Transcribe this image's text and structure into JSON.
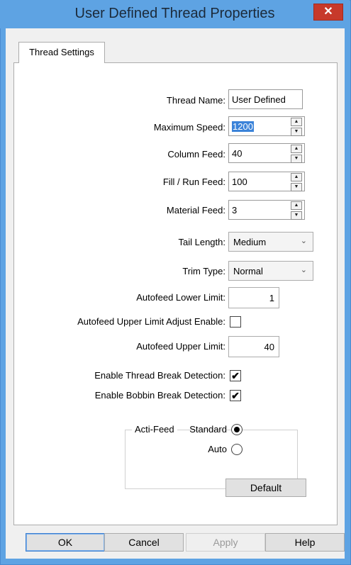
{
  "window": {
    "title": "User Defined Thread Properties",
    "close_glyph": "✕"
  },
  "tabs": [
    {
      "label": "Thread Settings"
    }
  ],
  "fields": {
    "thread_name": {
      "label": "Thread Name:",
      "value": "User Defined"
    },
    "maximum_speed": {
      "label": "Maximum Speed:",
      "value": "1200"
    },
    "column_feed": {
      "label": "Column Feed:",
      "value": "40"
    },
    "fill_run_feed": {
      "label": "Fill / Run Feed:",
      "value": "100"
    },
    "material_feed": {
      "label": "Material Feed:",
      "value": "3"
    },
    "tail_length": {
      "label": "Tail Length:",
      "value": "Medium"
    },
    "trim_type": {
      "label": "Trim Type:",
      "value": "Normal"
    },
    "autofeed_lower_limit": {
      "label": "Autofeed Lower Limit:",
      "value": "1"
    },
    "autofeed_upper_adjust": {
      "label": "Autofeed Upper Limit Adjust Enable:",
      "checked": false
    },
    "autofeed_upper_limit": {
      "label": "Autofeed Upper Limit:",
      "value": "40"
    },
    "thread_break_detection": {
      "label": "Enable Thread Break Detection:",
      "checked": true
    },
    "bobbin_break_detection": {
      "label": "Enable Bobbin Break Detection:",
      "checked": true
    }
  },
  "acti_feed": {
    "title": "Acti-Feed",
    "options": [
      {
        "label": "Standard",
        "selected": true
      },
      {
        "label": "Auto",
        "selected": false
      }
    ]
  },
  "check_glyph": "✔",
  "spin_glyphs": {
    "up": "▲",
    "down": "▼"
  },
  "dropdown_glyph": "⌄",
  "buttons": {
    "default": "Default",
    "ok": "OK",
    "cancel": "Cancel",
    "apply": "Apply",
    "help": "Help"
  },
  "colors": {
    "titlebar": "#5ea3e3",
    "close": "#c7392b"
  }
}
